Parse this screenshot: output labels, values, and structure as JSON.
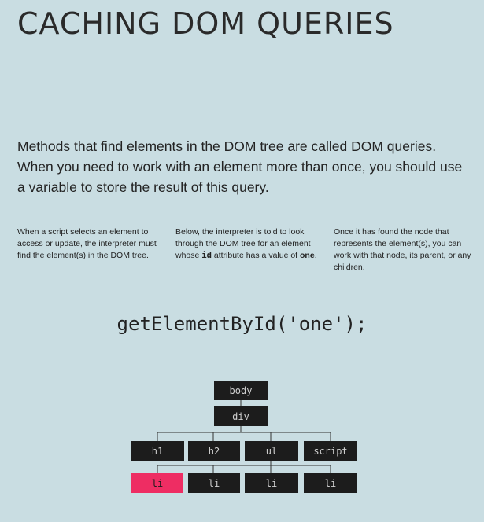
{
  "title": "CACHING DOM QUERIES",
  "intro": "Methods that find elements in the DOM tree are called DOM queries. When you need to work with an element more than once, you should use a variable to store the result of this query.",
  "columns": {
    "col1": "When a script selects an element to access or update, the interpreter must find the element(s) in the DOM tree.",
    "col2": {
      "part1": "Below, the interpreter is told to look through the DOM tree for an element whose ",
      "code": "id",
      "part2": " attribute has a value of ",
      "value": "one",
      "part3": "."
    },
    "col3": "Once it has found the node that represents the element(s), you can work with that node, its parent, or any children."
  },
  "code": "getElementById('one');",
  "tree": {
    "root": "body",
    "level1": "div",
    "level2": [
      "h1",
      "h2",
      "ul",
      "script"
    ],
    "level3": [
      "li",
      "li",
      "li",
      "li"
    ],
    "highlight_color": "#ee2d63"
  }
}
